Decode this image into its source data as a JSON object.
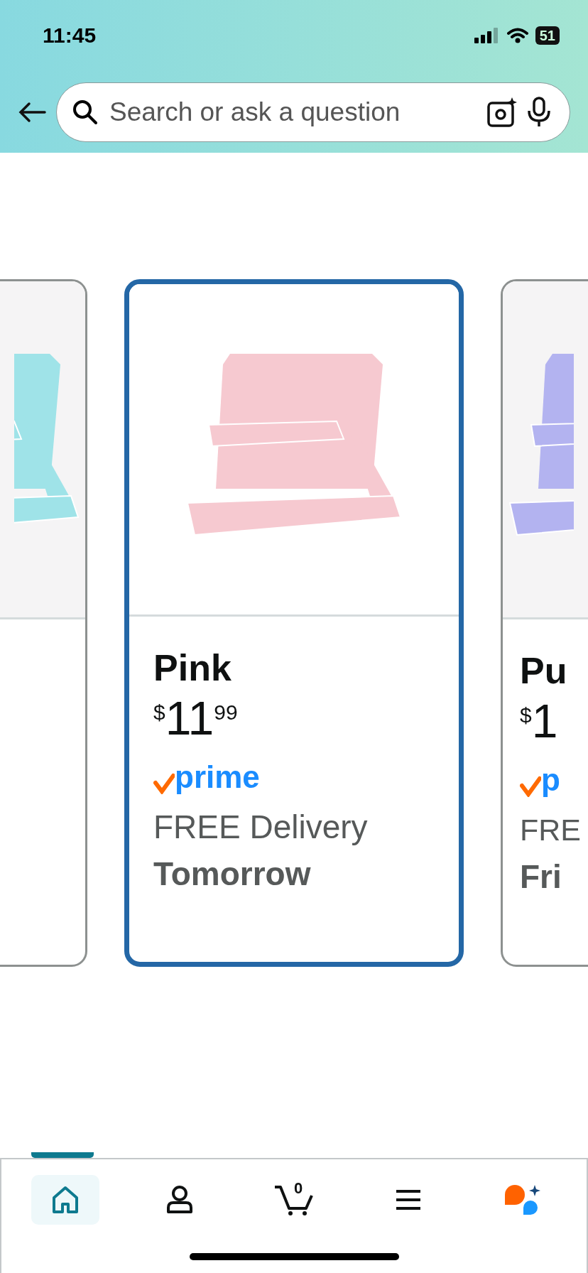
{
  "status_bar": {
    "time": "11:45",
    "battery": "51"
  },
  "search": {
    "placeholder": "Search or ask a question"
  },
  "cards": [
    {
      "selected": false,
      "color": "#9fe3e8"
    },
    {
      "selected": true,
      "color": "#f6c9d0",
      "name": "Pink",
      "price": {
        "symbol": "$",
        "whole": "11",
        "fraction": "99"
      },
      "prime": "prime",
      "delivery": "FREE Delivery",
      "day": "Tomorrow"
    },
    {
      "selected": false,
      "color": "#b3b3f0",
      "name": "Pu",
      "price": {
        "symbol": "$",
        "whole": "1"
      },
      "prime": "p",
      "delivery": "FRE",
      "day": "Fri"
    }
  ],
  "nav": [
    {
      "kind": "home",
      "selected": true
    },
    {
      "kind": "account",
      "selected": false
    },
    {
      "kind": "cart",
      "selected": false,
      "count": "0"
    },
    {
      "kind": "menu",
      "selected": false
    },
    {
      "kind": "assistant",
      "selected": false
    }
  ]
}
